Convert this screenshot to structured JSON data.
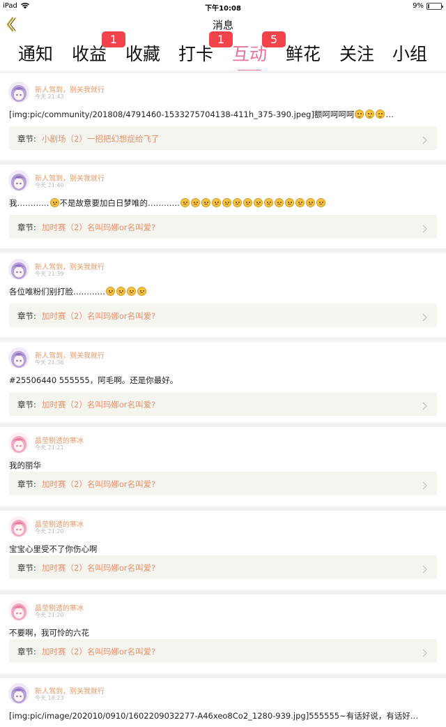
{
  "status_bar": {
    "device": "iPad",
    "time": "下午10:08",
    "battery": "9%",
    "battery_level": 0.09
  },
  "nav": {
    "title": "消息"
  },
  "tabs": [
    {
      "label": "通知",
      "active": false,
      "badge": ""
    },
    {
      "label": "收益",
      "active": false,
      "badge": "1"
    },
    {
      "label": "收藏",
      "active": false,
      "badge": ""
    },
    {
      "label": "打卡",
      "active": false,
      "badge": "1"
    },
    {
      "label": "互动",
      "active": true,
      "badge": "5"
    },
    {
      "label": "鲜花",
      "active": false,
      "badge": ""
    },
    {
      "label": "关注",
      "active": false,
      "badge": ""
    },
    {
      "label": "小组",
      "active": false,
      "badge": ""
    }
  ],
  "chapter_label": "章节:",
  "items": [
    {
      "user": "新人驾到，别关我就行",
      "time": "今天 21:43",
      "avatar": "purple",
      "content": "[img:pic/community/201808/4791460-1533275704138-411h_375-390.jpeg]额呵呵呵呵",
      "emojis": [
        "grin",
        "grin",
        "grin"
      ],
      "emoji_suffix": "…",
      "chapter": "小剧场（2）一招把幻想症给飞了"
    },
    {
      "user": "新人驾到，别关我就行",
      "time": "今天 21:40",
      "avatar": "purple",
      "content": "我…………",
      "content2": "不是故意要加白日梦唯的…………",
      "emojis_mid": [
        "sad"
      ],
      "emojis": [
        "sad",
        "sad",
        "sad",
        "sad",
        "sad",
        "sad",
        "sad",
        "sad",
        "sad",
        "sad",
        "sad",
        "sad",
        "sad",
        "sad"
      ],
      "emoji_suffix": "",
      "chapter": "加时赛（2）名叫玛娜or名叫爱?"
    },
    {
      "user": "新人驾到，别关我就行",
      "time": "今天 21:39",
      "avatar": "purple",
      "content": "各位唯粉们别打脸…………",
      "emojis": [
        "sad",
        "sad",
        "sad",
        "sad"
      ],
      "emoji_suffix": "",
      "chapter": "加时赛（2）名叫玛娜or名叫爱?"
    },
    {
      "user": "新人驾到，别关我就行",
      "time": "今天 21:36",
      "avatar": "purple",
      "content": "#25506440 555555，阿毛啊。还是你最好。",
      "emojis": [],
      "emoji_suffix": "",
      "chapter": "加时赛（2）名叫玛娜or名叫爱?"
    },
    {
      "user": "晶莹剔透的寒冰",
      "time": "今天 21:21",
      "avatar": "pink",
      "content": "我的丽华",
      "emojis": [],
      "emoji_suffix": "",
      "chapter": "加时赛（2）名叫玛娜or名叫爱?"
    },
    {
      "user": "晶莹剔透的寒冰",
      "time": "今天 21:20",
      "avatar": "pink",
      "content": "宝宝心里受不了你伤心啊",
      "emojis": [],
      "emoji_suffix": "",
      "chapter": "加时赛（2）名叫玛娜or名叫爱?"
    },
    {
      "user": "晶莹剔透的寒冰",
      "time": "今天 21:20",
      "avatar": "pink",
      "content": "不要啊，我可怜的六花",
      "emojis": [],
      "emoji_suffix": "",
      "chapter": "加时赛（2）名叫玛娜or名叫爱?"
    },
    {
      "user": "新人驾到，别关我就行",
      "time": "今天 18:23",
      "avatar": "purple",
      "content": "[img:pic/image/202010/0910/1602209032277-A46xeo8Co2_1280-939.jpg]555555~有话好说，有话好…",
      "emojis": [],
      "emoji_suffix": "",
      "chapter": ""
    }
  ]
}
